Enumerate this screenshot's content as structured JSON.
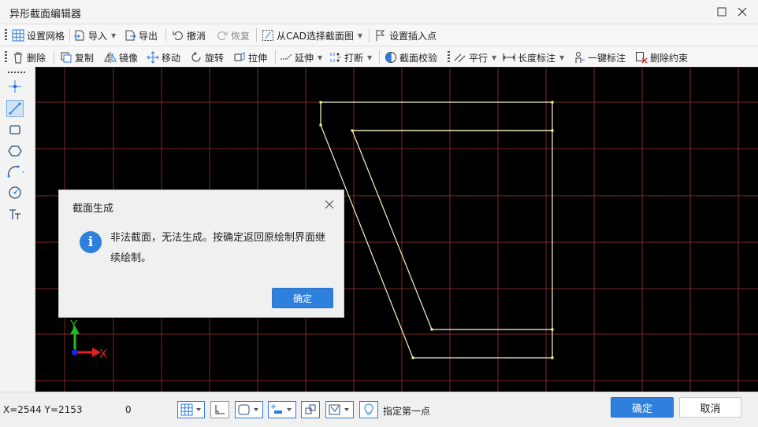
{
  "window": {
    "title": "异形截面编辑器"
  },
  "toolbar1": {
    "set_grid": "设置网格",
    "import": "导入",
    "export": "导出",
    "undo": "撤消",
    "redo": "恢复",
    "from_cad": "从CAD选择截面图",
    "set_insert_point": "设置插入点"
  },
  "toolbar2": {
    "delete": "删除",
    "copy": "复制",
    "mirror": "镜像",
    "move": "移动",
    "rotate": "旋转",
    "stretch": "拉伸",
    "extend": "延伸",
    "break": "打断",
    "check": "截面校验",
    "parallel": "平行",
    "length_dim": "长度标注",
    "one_key_dim": "一键标注",
    "delete_constraint": "删除约束"
  },
  "left_tools": [
    "point-tool",
    "line-tool",
    "rectangle-tool",
    "polygon-tool",
    "arc-tool",
    "circle-tool",
    "text-tool"
  ],
  "canvas": {
    "axis_x": "X",
    "axis_y": "Y",
    "grid_color": "#7a2a2a",
    "shape_color": "#f5f5c8"
  },
  "dialog": {
    "title": "截面生成",
    "message": "非法截面，无法生成。按确定返回原绘制界面继续绘制。",
    "ok": "确定"
  },
  "status": {
    "coords": "X=2544 Y=2153",
    "count": "0",
    "hint": "指定第一点",
    "ok": "确定",
    "cancel": "取消"
  }
}
